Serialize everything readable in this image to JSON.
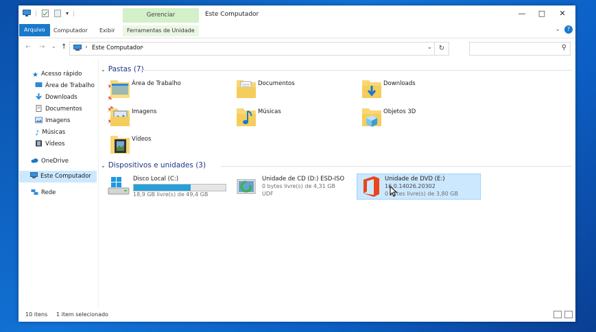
{
  "window": {
    "title": "Este Computador",
    "manage_tab": "Gerenciar"
  },
  "ribbon": {
    "tabs": [
      "Arquivo",
      "Computador",
      "Exibir",
      "Ferramentas de Unidade"
    ],
    "help": "?"
  },
  "address": {
    "path": "Este Computador",
    "separator": "›"
  },
  "sidebar": {
    "items": [
      {
        "label": "Acesso rápido",
        "icon": "star-icon"
      },
      {
        "label": "Área de Trabalho",
        "icon": "desktop-icon",
        "pinned": true
      },
      {
        "label": "Downloads",
        "icon": "download-icon",
        "pinned": true
      },
      {
        "label": "Documentos",
        "icon": "document-icon",
        "pinned": true
      },
      {
        "label": "Imagens",
        "icon": "image-icon",
        "pinned": true
      },
      {
        "label": "Músicas",
        "icon": "music-icon"
      },
      {
        "label": "Vídeos",
        "icon": "video-icon"
      },
      {
        "label": "OneDrive",
        "icon": "cloud-icon"
      },
      {
        "label": "Este Computador",
        "icon": "pc-icon",
        "selected": true
      },
      {
        "label": "Rede",
        "icon": "network-icon"
      }
    ]
  },
  "content": {
    "folders_header": "Pastas (7)",
    "folders": [
      {
        "label": "Área de Trabalho",
        "icon": "desktop-folder-icon"
      },
      {
        "label": "Documentos",
        "icon": "documents-folder-icon"
      },
      {
        "label": "Downloads",
        "icon": "downloads-folder-icon"
      },
      {
        "label": "Imagens",
        "icon": "pictures-folder-icon"
      },
      {
        "label": "Músicas",
        "icon": "music-folder-icon"
      },
      {
        "label": "Objetos 3D",
        "icon": "3d-objects-folder-icon"
      },
      {
        "label": "Vídeos",
        "icon": "videos-folder-icon"
      }
    ],
    "devices_header": "Dispositivos e unidades (3)",
    "drives": [
      {
        "name": "Disco Local (C:)",
        "line1": "18,9 GB livre(s) de 49,4 GB",
        "used_fraction": 0.62,
        "icon": "hard-drive-icon"
      },
      {
        "name": "Unidade de CD (D:) ESD-ISO",
        "line1": "0 bytes livre(s) de 4,31 GB",
        "line2": "UDF",
        "icon": "cd-drive-icon"
      },
      {
        "name": "Unidade de DVD (E:)",
        "line1": "16.0.14026.20302",
        "line2": "0 bytes livre(s) de 3,80 GB",
        "icon": "office-logo-icon",
        "selected": true
      }
    ]
  },
  "status": {
    "count": "10 itens",
    "selected": "1 item selecionado"
  },
  "colors": {
    "accent": "#1979ca",
    "manage_tab": "#d3f0c8",
    "selection": "#cce8ff",
    "progress": "#26a0da",
    "office_orange": "#e8461b"
  }
}
